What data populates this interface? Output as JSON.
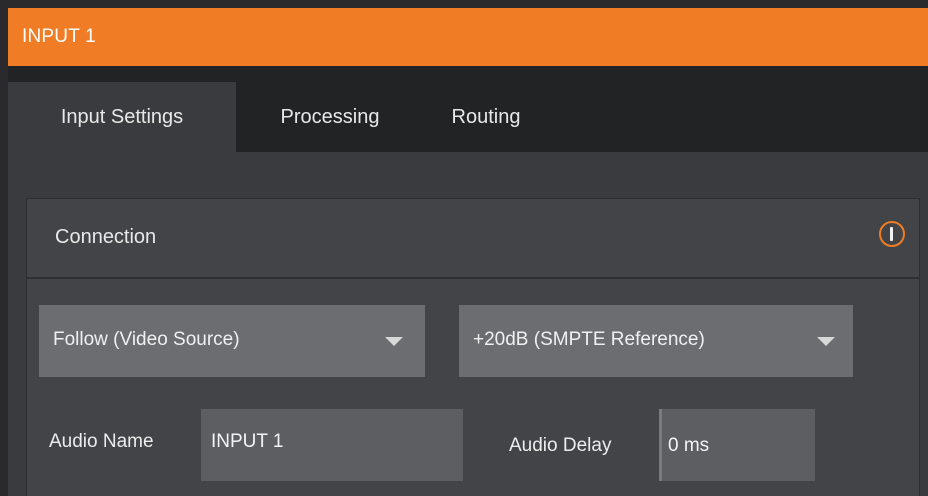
{
  "window": {
    "title": "INPUT 1"
  },
  "tabs": [
    {
      "label": "Input Settings",
      "active": true
    },
    {
      "label": "Processing",
      "active": false
    },
    {
      "label": "Routing",
      "active": false
    }
  ],
  "connection": {
    "title": "Connection",
    "info_icon": "info-icon",
    "source_select": {
      "value": "Follow (Video Source)"
    },
    "level_select": {
      "value": "+20dB (SMPTE Reference)"
    },
    "audio_name": {
      "label": "Audio Name",
      "value": "INPUT 1"
    },
    "audio_delay": {
      "label": "Audio Delay",
      "value": "0 ms"
    }
  },
  "colors": {
    "accent": "#f07d26",
    "background": "#3a3b3e",
    "tab_strip": "#222325",
    "field": "#5d5e62"
  }
}
